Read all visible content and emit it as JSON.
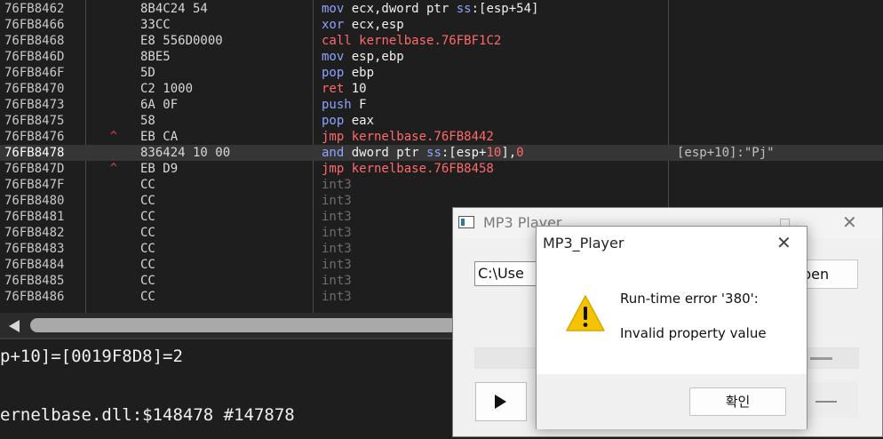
{
  "disassembly": {
    "rows": [
      {
        "addr": "76FB8462",
        "arrow": "",
        "bytes": "8B4C24 54",
        "instr": [
          {
            "t": "mov ",
            "c": "m"
          },
          {
            "t": "ecx,dword ptr ",
            "c": "op"
          },
          {
            "t": "ss",
            "c": "seg"
          },
          {
            "t": ":[esp+54]",
            "c": "op"
          }
        ],
        "comment": ""
      },
      {
        "addr": "76FB8466",
        "arrow": "",
        "bytes": "33CC",
        "instr": [
          {
            "t": "xor ",
            "c": "m"
          },
          {
            "t": "ecx,esp",
            "c": "op"
          }
        ],
        "comment": ""
      },
      {
        "addr": "76FB8468",
        "arrow": "",
        "bytes": "E8 556D0000",
        "instr": [
          {
            "t": "call ",
            "c": "m-j"
          },
          {
            "t": "kernelbase.76FBF1C2",
            "c": "lab"
          }
        ],
        "comment": ""
      },
      {
        "addr": "76FB846D",
        "arrow": "",
        "bytes": "8BE5",
        "instr": [
          {
            "t": "mov ",
            "c": "m"
          },
          {
            "t": "esp,ebp",
            "c": "op"
          }
        ],
        "comment": ""
      },
      {
        "addr": "76FB846F",
        "arrow": "",
        "bytes": "5D",
        "instr": [
          {
            "t": "pop ",
            "c": "m"
          },
          {
            "t": "ebp",
            "c": "op"
          }
        ],
        "comment": ""
      },
      {
        "addr": "76FB8470",
        "arrow": "",
        "bytes": "C2 1000",
        "instr": [
          {
            "t": "ret ",
            "c": "m-j"
          },
          {
            "t": "10",
            "c": "num"
          }
        ],
        "comment": ""
      },
      {
        "addr": "76FB8473",
        "arrow": "",
        "bytes": "6A 0F",
        "instr": [
          {
            "t": "push ",
            "c": "m"
          },
          {
            "t": "F",
            "c": "num"
          }
        ],
        "comment": ""
      },
      {
        "addr": "76FB8475",
        "arrow": "",
        "bytes": "58",
        "instr": [
          {
            "t": "pop ",
            "c": "m"
          },
          {
            "t": "eax",
            "c": "op"
          }
        ],
        "comment": ""
      },
      {
        "addr": "76FB8476",
        "arrow": "^",
        "bytes": "EB CA",
        "instr": [
          {
            "t": "jmp ",
            "c": "m-j"
          },
          {
            "t": "kernelbase.76FB8442",
            "c": "lab"
          }
        ],
        "comment": ""
      },
      {
        "addr": "76FB8478",
        "arrow": "",
        "bytes": "836424 10 00",
        "instr": [
          {
            "t": "and ",
            "c": "m"
          },
          {
            "t": "dword ptr ",
            "c": "op"
          },
          {
            "t": "ss",
            "c": "seg"
          },
          {
            "t": ":[esp+",
            "c": "op"
          },
          {
            "t": "10",
            "c": "lab"
          },
          {
            "t": "],",
            "c": "op"
          },
          {
            "t": "0",
            "c": "lab"
          }
        ],
        "comment": "[esp+10]:\"Pj\"",
        "selected": true
      },
      {
        "addr": "76FB847D",
        "arrow": "^",
        "bytes": "EB D9",
        "instr": [
          {
            "t": "jmp ",
            "c": "m-j"
          },
          {
            "t": "kernelbase.76FB8458",
            "c": "lab"
          }
        ],
        "comment": ""
      },
      {
        "addr": "76FB847F",
        "arrow": "",
        "bytes": "CC",
        "instr": [
          {
            "t": "int3",
            "c": "m-pad"
          }
        ],
        "comment": ""
      },
      {
        "addr": "76FB8480",
        "arrow": "",
        "bytes": "CC",
        "instr": [
          {
            "t": "int3",
            "c": "m-pad"
          }
        ],
        "comment": ""
      },
      {
        "addr": "76FB8481",
        "arrow": "",
        "bytes": "CC",
        "instr": [
          {
            "t": "int3",
            "c": "m-pad"
          }
        ],
        "comment": ""
      },
      {
        "addr": "76FB8482",
        "arrow": "",
        "bytes": "CC",
        "instr": [
          {
            "t": "int3",
            "c": "m-pad"
          }
        ],
        "comment": ""
      },
      {
        "addr": "76FB8483",
        "arrow": "",
        "bytes": "CC",
        "instr": [
          {
            "t": "int3",
            "c": "m-pad"
          }
        ],
        "comment": ""
      },
      {
        "addr": "76FB8484",
        "arrow": "",
        "bytes": "CC",
        "instr": [
          {
            "t": "int3",
            "c": "m-pad"
          }
        ],
        "comment": ""
      },
      {
        "addr": "76FB8485",
        "arrow": "",
        "bytes": "CC",
        "instr": [
          {
            "t": "int3",
            "c": "m-pad"
          }
        ],
        "comment": ""
      },
      {
        "addr": "76FB8486",
        "arrow": "",
        "bytes": "CC",
        "instr": [
          {
            "t": "int3",
            "c": "m-pad"
          }
        ],
        "comment": ""
      }
    ]
  },
  "info_panel": {
    "line1": "p+10]=[0019F8D8]=2",
    "line2": "ernelbase.dll:$148478 #147878"
  },
  "mp3_window": {
    "title": "MP3 Player",
    "path_value": "C:\\Use",
    "open_button": "pen",
    "close_glyph": "✕"
  },
  "dialog": {
    "title": "MP3_Player",
    "close_glyph": "✕",
    "message_line1": "Run-time error '380':",
    "message_line2": "Invalid property value",
    "ok_button": "확인",
    "warning_color": "#f4c400"
  }
}
